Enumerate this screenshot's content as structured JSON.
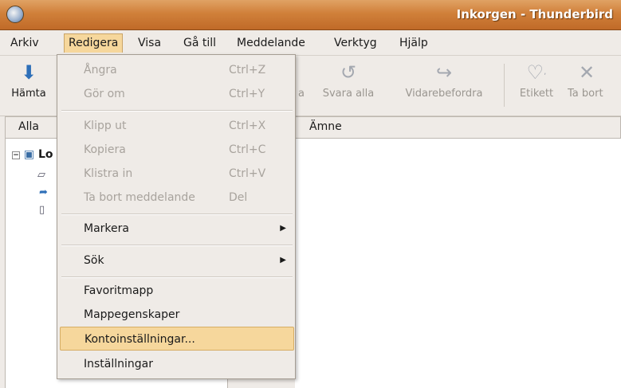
{
  "window": {
    "title": "Inkorgen - Thunderbird"
  },
  "menubar": {
    "items": [
      {
        "label": "Arkiv"
      },
      {
        "label": "Redigera"
      },
      {
        "label": "Visa"
      },
      {
        "label": "Gå till"
      },
      {
        "label": "Meddelande"
      },
      {
        "label": "Verktyg"
      },
      {
        "label": "Hjälp"
      }
    ]
  },
  "toolbar": {
    "hamta": "Hämta",
    "svara_partial": "a",
    "svara_alla": "Svara alla",
    "vidarebefordra": "Vidarebefordra",
    "etikett": "Etikett",
    "ta_bort": "Ta bort"
  },
  "folder_pane": {
    "header": "Alla",
    "root_label": "Lo"
  },
  "message_list": {
    "column_subject": "Ämne"
  },
  "edit_menu": {
    "items": [
      {
        "label": "Ångra",
        "accel": "Ctrl+Z"
      },
      {
        "label": "Gör om",
        "accel": "Ctrl+Y"
      },
      {
        "label": "Klipp ut",
        "accel": "Ctrl+X"
      },
      {
        "label": "Kopiera",
        "accel": "Ctrl+C"
      },
      {
        "label": "Klistra in",
        "accel": "Ctrl+V"
      },
      {
        "label": "Ta bort meddelande",
        "accel": "Del"
      },
      {
        "label": "Markera"
      },
      {
        "label": "Sök"
      },
      {
        "label": "Favoritmapp"
      },
      {
        "label": "Mappegenskaper"
      },
      {
        "label": "Kontoinställningar..."
      },
      {
        "label": "Inställningar"
      }
    ]
  },
  "colors": {
    "titlebar": "#d0803a",
    "highlight": "#f6d79c"
  }
}
